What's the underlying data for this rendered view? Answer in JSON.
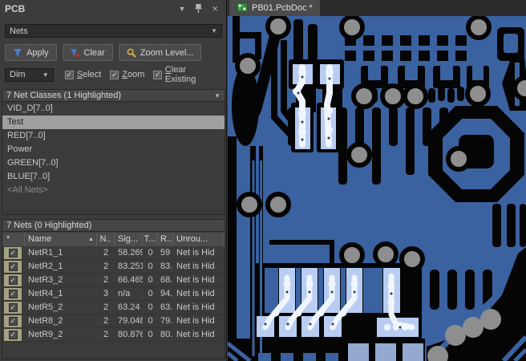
{
  "panel": {
    "title": "PCB",
    "mode_select": {
      "value": "Nets"
    },
    "toolbar": {
      "apply_label": "Apply",
      "clear_label": "Clear",
      "zoom_level_label": "Zoom Level..."
    },
    "dim_row": {
      "dim_select": {
        "value": "Dim"
      },
      "checkboxes": [
        {
          "label": "Select",
          "checked": true
        },
        {
          "label": "Zoom",
          "checked": true
        },
        {
          "label": "Clear Existing",
          "checked": true
        }
      ]
    },
    "net_classes": {
      "header": "7 Net Classes (1 Highlighted)",
      "items": [
        {
          "name": "VID_D[7..0]",
          "selected": false
        },
        {
          "name": "Test",
          "selected": true
        },
        {
          "name": "RED[7..0]",
          "selected": false
        },
        {
          "name": "Power",
          "selected": false
        },
        {
          "name": "GREEN[7..0]",
          "selected": false
        },
        {
          "name": "BLUE[7..0]",
          "selected": false
        },
        {
          "name": "<All Nets>",
          "selected": false
        }
      ]
    },
    "nets": {
      "header": "7 Nets (0 Highlighted)",
      "columns": {
        "star": "*",
        "name": "Name",
        "nodes": "N..",
        "signal": "Sig...",
        "t": "T...",
        "r": "R...",
        "unrouted": "Unrou..."
      },
      "rows": [
        {
          "checked": true,
          "name": "NetR1_1",
          "nodes": "2",
          "signal": "58.269",
          "t": "0",
          "r": "59",
          "unrouted": "Net is Hid"
        },
        {
          "checked": true,
          "name": "NetR2_1",
          "nodes": "2",
          "signal": "83.251",
          "t": "0",
          "r": "83.",
          "unrouted": "Net is Hid"
        },
        {
          "checked": true,
          "name": "NetR3_2",
          "nodes": "2",
          "signal": "66.465",
          "t": "0",
          "r": "68.",
          "unrouted": "Net is Hid"
        },
        {
          "checked": true,
          "name": "NetR4_1",
          "nodes": "3",
          "signal": "n/a",
          "t": "0",
          "r": "94.",
          "unrouted": "Net is Hid"
        },
        {
          "checked": true,
          "name": "NetR5_2",
          "nodes": "2",
          "signal": "63.24",
          "t": "0",
          "r": "63.",
          "unrouted": "Net is Hid"
        },
        {
          "checked": true,
          "name": "NetR8_2",
          "nodes": "2",
          "signal": "79.048",
          "t": "0",
          "r": "79.",
          "unrouted": "Net is Hid"
        },
        {
          "checked": true,
          "name": "NetR9_2",
          "nodes": "2",
          "signal": "80.876",
          "t": "0",
          "r": "80.",
          "unrouted": "Net is Hid"
        }
      ]
    }
  },
  "editor": {
    "tab_label": "PB01.PcbDoc *"
  },
  "icons": {
    "check": "✓",
    "dropdown": "▼",
    "close": "✕",
    "sort_asc": "▲"
  },
  "colors": {
    "panel_bg": "#3c3c3c",
    "selection_bg": "#9f9f9f",
    "header_bar": "#454545",
    "copper_blue": "#3a62a0",
    "board_black": "#000000",
    "via_gray": "#8e8e8e",
    "highlight_pad": "#b9cdf2",
    "highlight_trace": "#f0f5ff",
    "bottom_pad_light": "#93a9cf",
    "apply_funnel": "#4a79d6",
    "clear_x": "#c03030",
    "magnifier": "#d9b24a",
    "tab_icon_green": "#3aa047"
  }
}
